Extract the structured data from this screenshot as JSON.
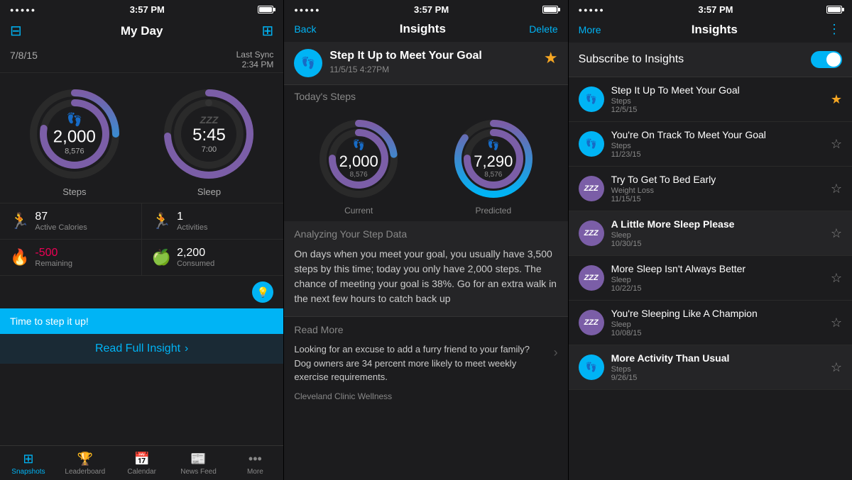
{
  "panel1": {
    "status": {
      "dots": "●●●●●",
      "time": "3:57 PM"
    },
    "title": "My Day",
    "date": "7/8/15",
    "sync_label": "Last Sync",
    "sync_time": "2:34 PM",
    "steps_ring": {
      "value": "2,000",
      "sub": "8,576",
      "label": "Steps",
      "icon": "👣",
      "percent": 23
    },
    "sleep_ring": {
      "value": "5:45",
      "sub": "7:00",
      "label": "Sleep",
      "icon": "ZZZ",
      "percent": 78
    },
    "stats": [
      {
        "icon": "🏃",
        "value": "87",
        "label": "Active Calories",
        "color": "blue",
        "negative": false
      },
      {
        "icon": "🏃",
        "value": "1",
        "label": "Activities",
        "color": "orange",
        "negative": false
      },
      {
        "icon": "🔥",
        "value": "-500",
        "label": "Remaining",
        "color": "red",
        "negative": true
      },
      {
        "icon": "🍏",
        "value": "2,200",
        "label": "Consumed",
        "color": "green",
        "negative": false
      }
    ],
    "alert": "Time to step it up!",
    "read_insight": "Read Full Insight",
    "nav_items": [
      {
        "icon": "⊞",
        "label": "Snapshots",
        "active": true
      },
      {
        "icon": "🏆",
        "label": "Leaderboard",
        "active": false
      },
      {
        "icon": "📅",
        "label": "Calendar",
        "active": false
      },
      {
        "icon": "📰",
        "label": "News Feed",
        "active": false
      },
      {
        "icon": "•••",
        "label": "More",
        "active": false
      }
    ]
  },
  "panel2": {
    "status": {
      "dots": "●●●●●",
      "time": "3:57 PM"
    },
    "nav_back": "Back",
    "title": "Insights",
    "nav_delete": "Delete",
    "insight": {
      "avatar_icon": "👣",
      "title": "Step It Up to Meet Your Goal",
      "date": "11/5/15 4:27PM",
      "starred": true
    },
    "today_steps_label": "Today's Steps",
    "current_ring": {
      "value": "2,000",
      "sub": "8,576",
      "label": "Current",
      "percent": 23
    },
    "predicted_ring": {
      "value": "7,290",
      "sub": "8,576",
      "label": "Predicted",
      "percent": 85
    },
    "analysis_label": "Analyzing Your Step Data",
    "analysis_text": "On days when you meet your goal, you usually have 3,500 steps by this time; today you only have 2,000 steps. The chance of meeting your goal is 38%. Go for an extra walk in the next few hours to catch back up",
    "read_more_label": "Read More",
    "read_more_text": "Looking for an excuse to add a furry friend to your family? Dog owners are 34 percent more likely to meet weekly exercise requirements.",
    "read_more_source": "Cleveland Clinic Wellness"
  },
  "panel3": {
    "status": {
      "dots": "●●●●●",
      "time": "3:57 PM"
    },
    "nav_more": "More",
    "title": "Insights",
    "nav_dots": "⋮",
    "subscribe_label": "Subscribe to Insights",
    "toggle_on": true,
    "insights": [
      {
        "avatar_type": "blue",
        "avatar_icon": "👣",
        "title": "Step It Up To Meet Your Goal",
        "category": "Steps",
        "date": "12/5/15",
        "starred": true
      },
      {
        "avatar_type": "blue",
        "avatar_icon": "👣",
        "title": "You're On Track To Meet Your Goal",
        "category": "Steps",
        "date": "11/23/15",
        "starred": false
      },
      {
        "avatar_type": "purple",
        "avatar_icon": "ZZZ",
        "title": "Try To Get To Bed Early",
        "category": "Weight Loss",
        "date": "11/15/15",
        "starred": false
      },
      {
        "avatar_type": "purple",
        "avatar_icon": "ZZZ",
        "title": "A Little More Sleep Please",
        "category": "Sleep",
        "date": "10/30/15",
        "starred": false,
        "bold": true
      },
      {
        "avatar_type": "purple",
        "avatar_icon": "ZZZ",
        "title": "More Sleep Isn't Always Better",
        "category": "Sleep",
        "date": "10/22/15",
        "starred": false
      },
      {
        "avatar_type": "purple",
        "avatar_icon": "ZZZ",
        "title": "You're Sleeping Like A Champion",
        "category": "Sleep",
        "date": "10/08/15",
        "starred": false
      },
      {
        "avatar_type": "blue",
        "avatar_icon": "👣",
        "title": "More Activity Than Usual",
        "category": "Steps",
        "date": "9/26/15",
        "starred": false,
        "bold": true
      }
    ]
  }
}
